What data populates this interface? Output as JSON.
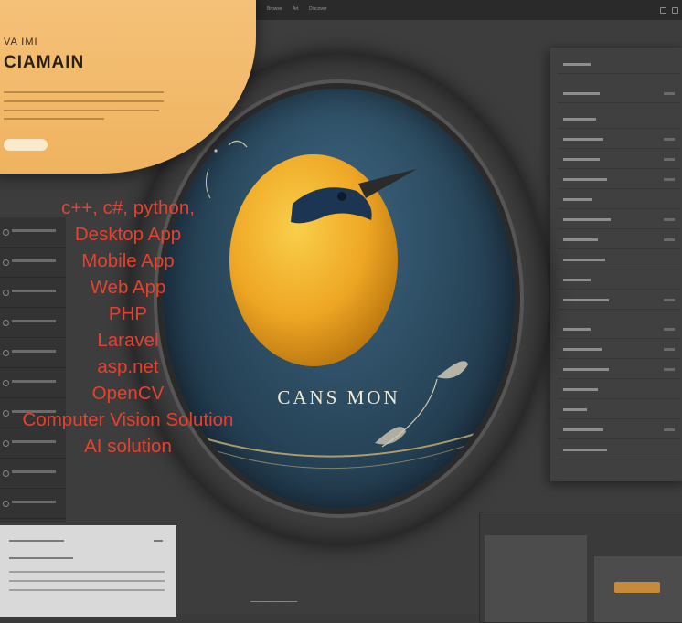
{
  "topbar": {
    "nav": [
      "Browse",
      "Art",
      "Discover"
    ]
  },
  "hero": {
    "eyebrow": "VA IMI",
    "title": "CIAMAIN"
  },
  "circle": {
    "title": "CANS MON"
  },
  "overlay": {
    "lines": [
      "c++, c#, python,",
      "Desktop App",
      "Mobile App",
      "Web App",
      "PHP",
      "Laravel",
      "asp.net",
      "OpenCV",
      "Computer Vision Solution",
      "AI solution"
    ]
  },
  "colors": {
    "accent": "#efb35f",
    "overlay_text": "#e8402e",
    "sky": "#284559",
    "bird": "#f2b928"
  }
}
